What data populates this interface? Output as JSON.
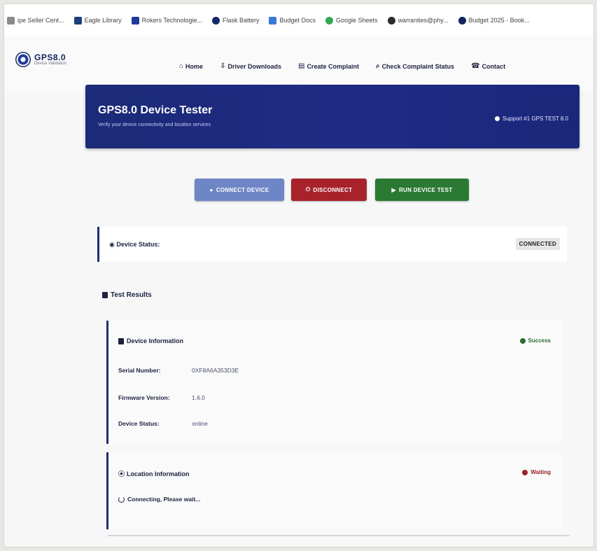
{
  "browser": {
    "bookmarks": [
      {
        "label": "ipe Seller Cent...",
        "color": "#8a8a8a"
      },
      {
        "label": "Eagle Library",
        "color": "#1d3f7a"
      },
      {
        "label": "Rokers Technologie...",
        "color": "#1f3a9a"
      },
      {
        "label": "Flask Battery",
        "color": "#102a6a"
      },
      {
        "label": "Budget Docs",
        "color": "#3b78d8"
      },
      {
        "label": "Google Sheets",
        "color": "#34a853"
      },
      {
        "label": "warranties@phy...",
        "color": "#2c2c2c"
      },
      {
        "label": "Budget 2025 - Book...",
        "color": "#12235f"
      }
    ]
  },
  "site": {
    "logo_title": "GPS8.0",
    "logo_subtitle": "Device Validation",
    "nav": [
      {
        "label": "Home",
        "icon": "home-icon"
      },
      {
        "label": "Driver Downloads",
        "icon": "download-icon"
      },
      {
        "label": "Create Complaint",
        "icon": "file-icon"
      },
      {
        "label": "Check Complaint Status",
        "icon": "search-icon"
      },
      {
        "label": "Contact",
        "icon": "phone-icon"
      }
    ]
  },
  "hero": {
    "title": "GPS8.0 Device Tester",
    "subtitle": "Verify your device connectivity and location services",
    "support": "Support #1 GPS TEST 8.0"
  },
  "actions": {
    "connect": "CONNECT DEVICE",
    "disconnect": "DISCONNECT",
    "run_test": "RUN DEVICE TEST"
  },
  "status": {
    "label": "Device Status:",
    "value": "CONNECTED"
  },
  "results": {
    "title": "Test Results",
    "device_info": {
      "title": "Device Information",
      "status": "Success",
      "rows": [
        {
          "label": "Serial Number:",
          "value": "0XF8A6A353D3E"
        },
        {
          "label": "Firmware Version:",
          "value": "1.6.0"
        },
        {
          "label": "Device Status:",
          "value": "online"
        }
      ]
    },
    "location_info": {
      "title": "Location Information",
      "status": "Waiting",
      "message": "Connecting, Please wait..."
    }
  }
}
